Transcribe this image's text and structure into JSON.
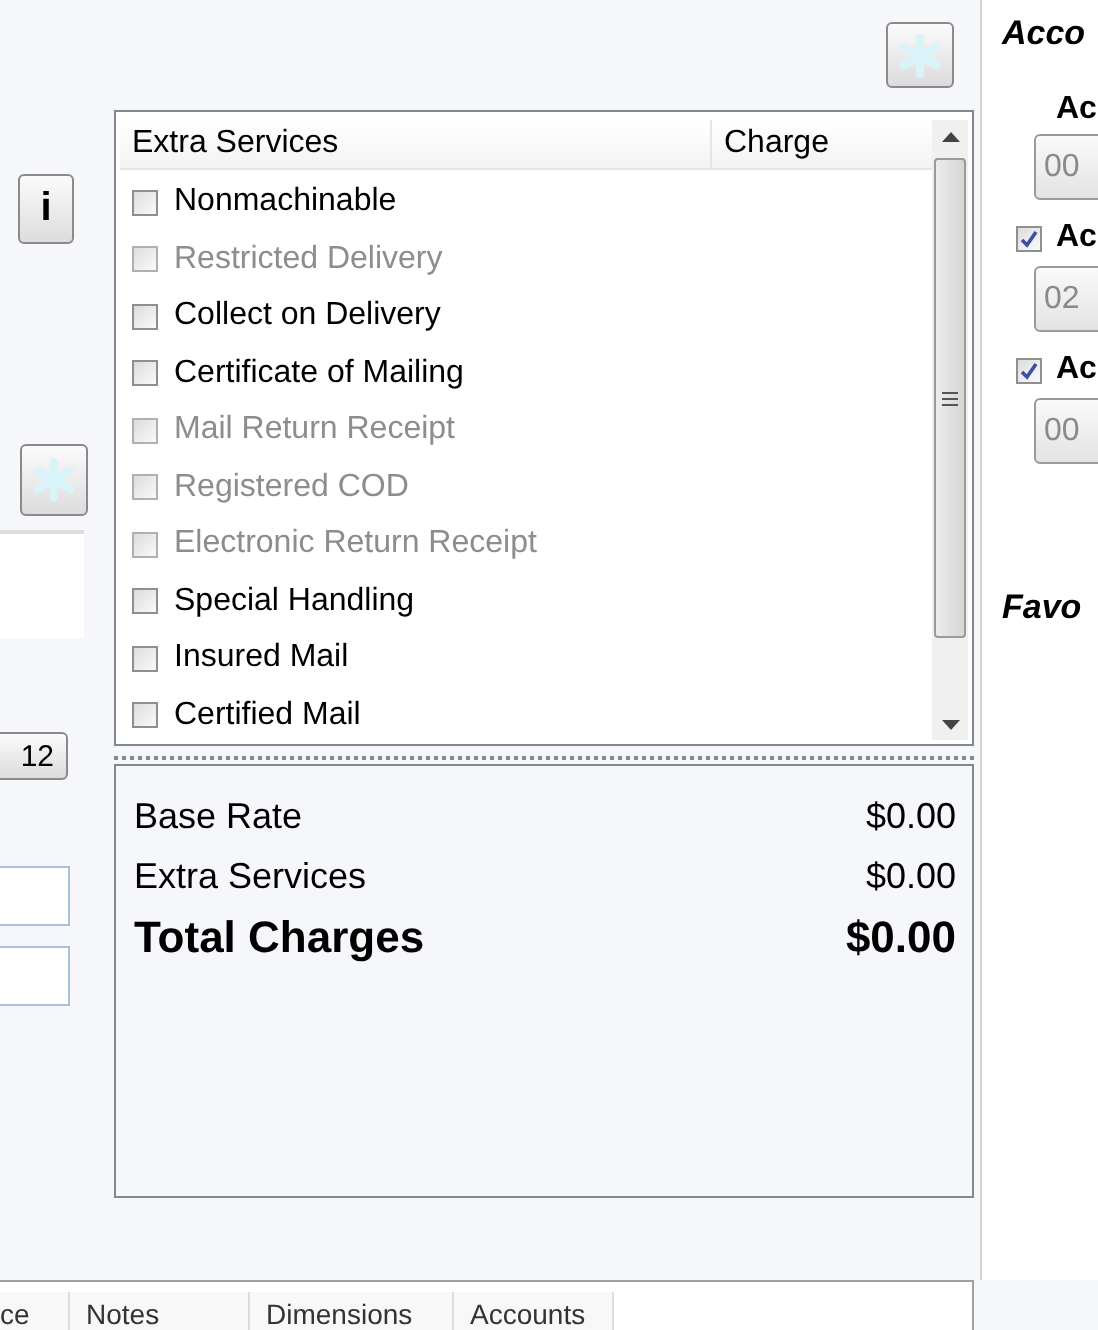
{
  "left_rail": {
    "info_button": "i",
    "size_button": "12"
  },
  "services": {
    "columns": [
      "Extra Services",
      "Charge"
    ],
    "items": [
      {
        "label": "Nonmachinable",
        "checked": false,
        "disabled": false
      },
      {
        "label": "Restricted Delivery",
        "checked": false,
        "disabled": true
      },
      {
        "label": "Collect on Delivery",
        "checked": false,
        "disabled": false
      },
      {
        "label": "Certificate of Mailing",
        "checked": false,
        "disabled": false
      },
      {
        "label": "Mail Return Receipt",
        "checked": false,
        "disabled": true
      },
      {
        "label": "Registered COD",
        "checked": false,
        "disabled": true
      },
      {
        "label": "Electronic Return Receipt",
        "checked": false,
        "disabled": true
      },
      {
        "label": "Special Handling",
        "checked": false,
        "disabled": false
      },
      {
        "label": "Insured Mail",
        "checked": false,
        "disabled": false
      },
      {
        "label": "Certified Mail",
        "checked": false,
        "disabled": false
      }
    ]
  },
  "summary": [
    {
      "label": "Base Rate",
      "value": "$0.00",
      "kind": "normal"
    },
    {
      "label": "Extra Services",
      "value": "$0.00",
      "kind": "normal"
    },
    {
      "label": "Total Charges",
      "value": "$0.00",
      "kind": "total"
    }
  ],
  "account_panel": {
    "title": "Acco",
    "label": "Ac",
    "fields": [
      {
        "value": "00"
      },
      {
        "label": "Ac",
        "checked": true,
        "value": "02"
      },
      {
        "label": "Ac",
        "checked": true,
        "value": "00"
      }
    ],
    "favorites_title": "Favo"
  },
  "bottom_tabs": [
    {
      "label": "ce",
      "selected": false
    },
    {
      "label": "Notes",
      "selected": false
    },
    {
      "label": "Dimensions",
      "selected": false
    },
    {
      "label": "Accounts",
      "selected": false
    }
  ]
}
